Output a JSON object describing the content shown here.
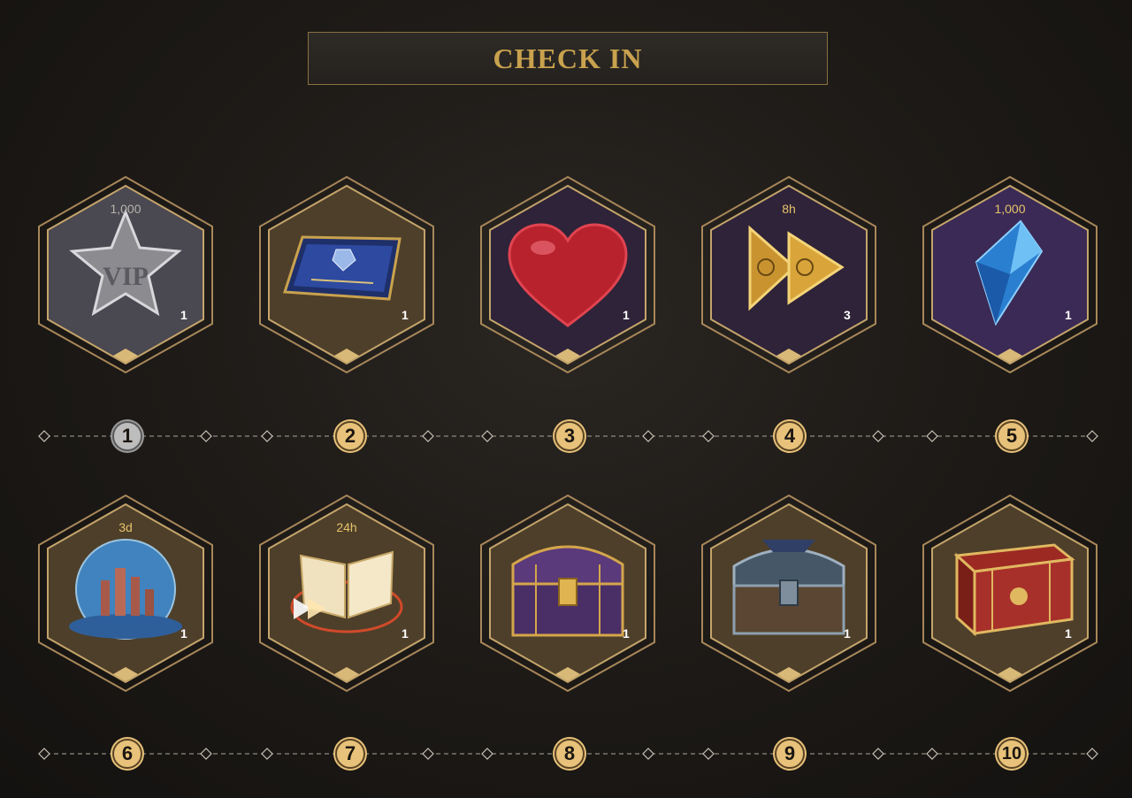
{
  "header": {
    "title": "CHECK IN"
  },
  "rewards": [
    {
      "day": "1",
      "top_label": "1,000",
      "quantity": "1",
      "item_icon": "vip-star-icon",
      "tile_color": "#4a4850"
    },
    {
      "day": "2",
      "top_label": "",
      "quantity": "1",
      "item_icon": "card-ticket-icon",
      "tile_color": "#4e3f2a"
    },
    {
      "day": "3",
      "top_label": "",
      "quantity": "1",
      "item_icon": "heart-icon",
      "tile_color": "#2e2338"
    },
    {
      "day": "4",
      "top_label": "8h",
      "quantity": "3",
      "item_icon": "speedup-icon",
      "tile_color": "#2e2338"
    },
    {
      "day": "5",
      "top_label": "1,000",
      "quantity": "1",
      "item_icon": "blue-crystal-icon",
      "tile_color": "#3a2a55"
    },
    {
      "day": "6",
      "top_label": "3d",
      "quantity": "1",
      "item_icon": "city-globe-icon",
      "tile_color": "#4e3f2a"
    },
    {
      "day": "7",
      "top_label": "24h",
      "quantity": "1",
      "item_icon": "magic-book-icon",
      "tile_color": "#4e3f2a"
    },
    {
      "day": "8",
      "top_label": "",
      "quantity": "1",
      "item_icon": "purple-chest-icon",
      "tile_color": "#4e3f2a"
    },
    {
      "day": "9",
      "top_label": "",
      "quantity": "1",
      "item_icon": "iron-chest-icon",
      "tile_color": "#4e3f2a"
    },
    {
      "day": "10",
      "top_label": "",
      "quantity": "1",
      "item_icon": "red-gold-chest-icon",
      "tile_color": "#4e3f2a"
    }
  ],
  "colors": {
    "accent_gold": "#c9a24e",
    "badge_gold": "#e8c27a",
    "badge_current": "#bdbdbd"
  }
}
